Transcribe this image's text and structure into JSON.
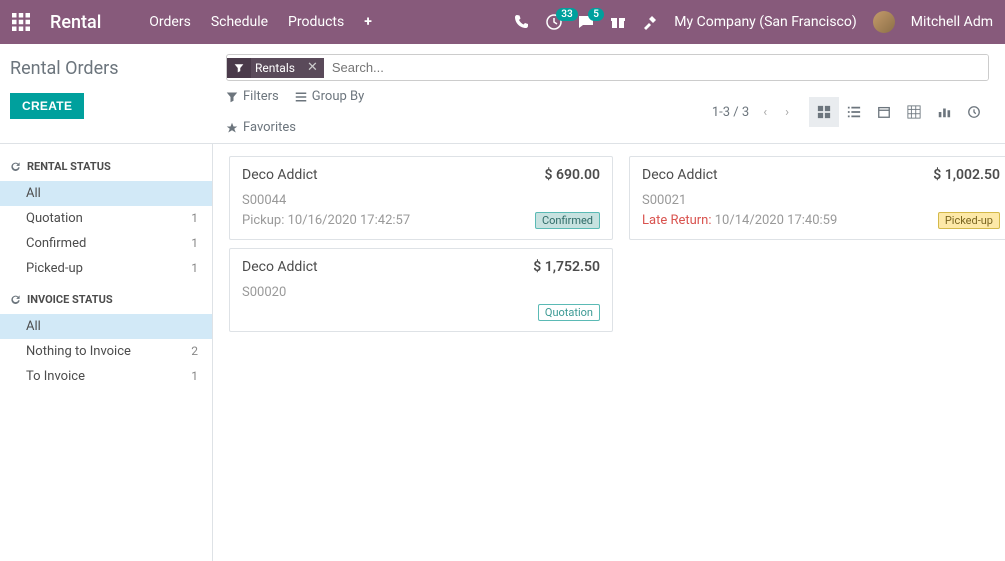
{
  "nav": {
    "brand": "Rental",
    "menu": [
      "Orders",
      "Schedule",
      "Products"
    ],
    "msg_badge": "33",
    "chat_badge": "5",
    "company": "My Company (San Francisco)",
    "user": "Mitchell Adm"
  },
  "control": {
    "breadcrumb": "Rental Orders",
    "create_label": "CREATE",
    "facet_label": "Rentals",
    "search_placeholder": "Search...",
    "filters_label": "Filters",
    "groupby_label": "Group By",
    "favorites_label": "Favorites",
    "pager": "1-3 / 3"
  },
  "sidebar": {
    "section1": "RENTAL STATUS",
    "items1": [
      {
        "label": "All",
        "count": ""
      },
      {
        "label": "Quotation",
        "count": "1"
      },
      {
        "label": "Confirmed",
        "count": "1"
      },
      {
        "label": "Picked-up",
        "count": "1"
      }
    ],
    "section2": "INVOICE STATUS",
    "items2": [
      {
        "label": "All",
        "count": ""
      },
      {
        "label": "Nothing to Invoice",
        "count": "2"
      },
      {
        "label": "To Invoice",
        "count": "1"
      }
    ]
  },
  "cards": {
    "col1": [
      {
        "title": "Deco Addict",
        "amount": "$ 690.00",
        "ref": "S00044",
        "date_label": "Pickup:",
        "date": "10/16/2020 17:42:57",
        "late": false,
        "status": "Confirmed",
        "status_class": "status-confirmed"
      },
      {
        "title": "Deco Addict",
        "amount": "$ 1,752.50",
        "ref": "S00020",
        "date_label": "",
        "date": "",
        "late": false,
        "status": "Quotation",
        "status_class": "status-quotation"
      }
    ],
    "col2": [
      {
        "title": "Deco Addict",
        "amount": "$ 1,002.50",
        "ref": "S00021",
        "date_label": "Late Return:",
        "date": "10/14/2020 17:40:59",
        "late": true,
        "status": "Picked-up",
        "status_class": "status-pickedup"
      }
    ]
  }
}
